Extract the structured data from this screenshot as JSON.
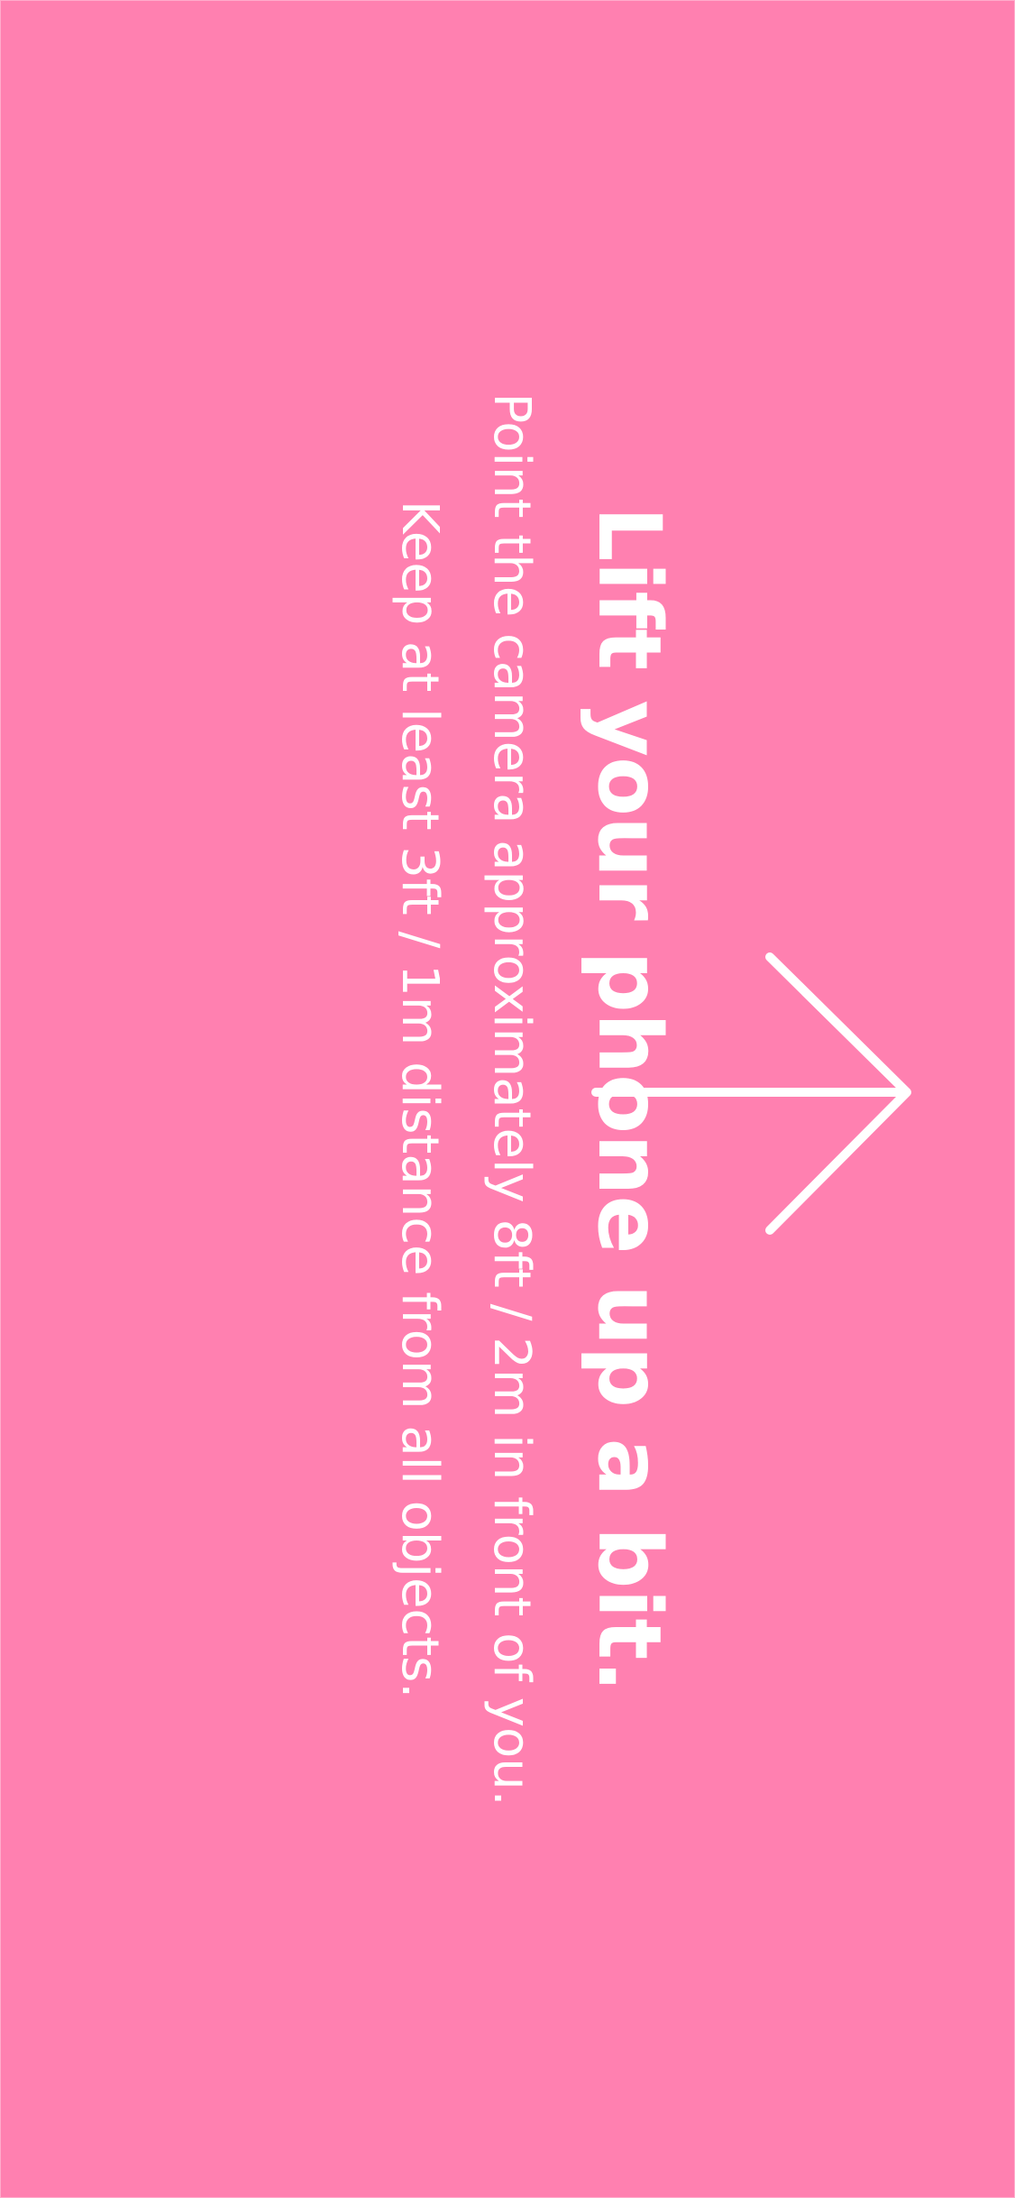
{
  "screen": {
    "background_color": "#ff80b0",
    "text_color": "#ffffff",
    "arrow_icon": "arrow-right-icon"
  },
  "instruction": {
    "title": "Lift your phone up a bit.",
    "lines": [
      "Point the camera approximately 8ft / 2m in front of you.",
      "Keep at least 3ft / 1m distance from all objects."
    ]
  }
}
